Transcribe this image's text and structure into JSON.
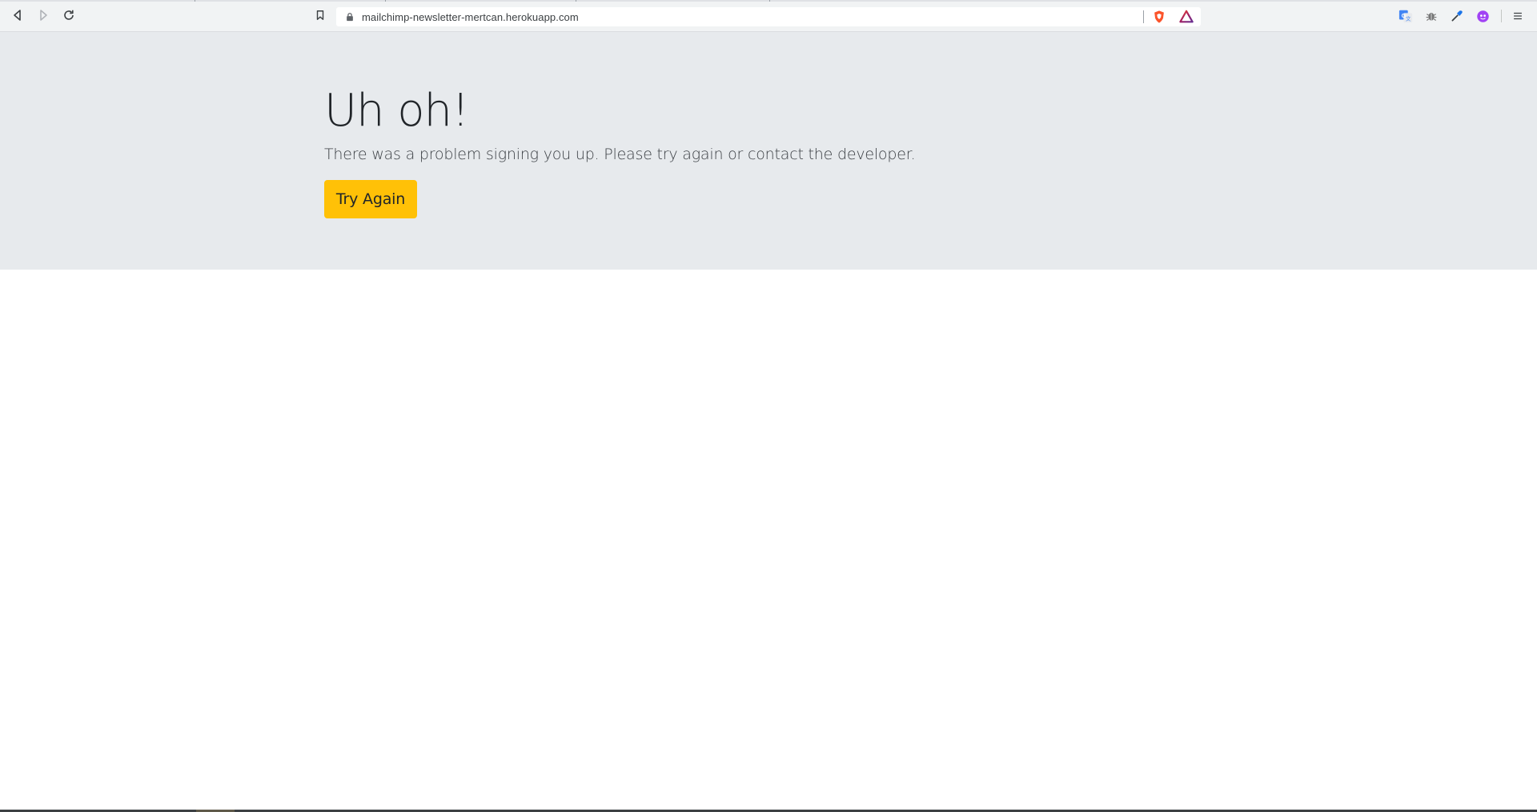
{
  "browser": {
    "url": "mailchimp-newsletter-mertcan.herokuapp.com",
    "nav": {
      "back_icon": "back-arrow-icon",
      "forward_icon": "forward-arrow-icon",
      "reload_icon": "reload-icon"
    },
    "bookmark_icon": "bookmark-icon",
    "lock_icon": "lock-icon",
    "shield_icon": "brave-shield-icon",
    "rewards_icon": "brave-rewards-icon",
    "extensions": [
      "translate-icon",
      "bug-icon",
      "eyedropper-icon",
      "profile-icon"
    ],
    "menu_icon": "hamburger-menu-icon"
  },
  "page": {
    "title": "Uh oh!",
    "lead": "There was a problem signing you up. Please try again or contact the developer.",
    "button_label": "Try Again"
  },
  "colors": {
    "jumbotron_bg": "#e7eaed",
    "button_bg": "#ffc107",
    "text": "#212529"
  }
}
